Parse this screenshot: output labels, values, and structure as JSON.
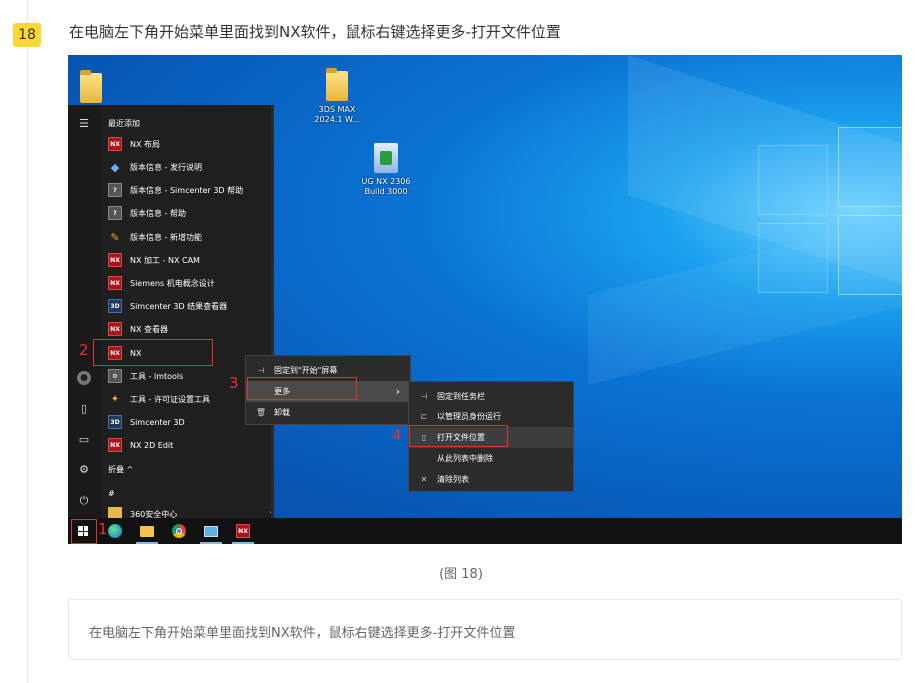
{
  "step": {
    "number": "18",
    "heading": "在电脑左下角开始菜单里面找到NX软件，鼠标右键选择更多-打开文件位置"
  },
  "desktop": {
    "icons": [
      {
        "label_line1": "3DS MAX",
        "label_line2": "2024.1 W...",
        "icon": "folder-icon"
      },
      {
        "label_line1": "UG NX 2306",
        "label_line2": "Build 3000",
        "icon": "nx-installer-icon"
      }
    ]
  },
  "start_menu": {
    "header": "最近添加",
    "items": [
      {
        "label": "NX 布局",
        "icon": "NX"
      },
      {
        "label": "版本信息 - 发行说明",
        "icon": "doc"
      },
      {
        "label": "版本信息 - Simcenter 3D 帮助",
        "icon": "help"
      },
      {
        "label": "版本信息 - 帮助",
        "icon": "help"
      },
      {
        "label": "版本信息 - 新增功能",
        "icon": "new"
      },
      {
        "label": "NX 加工 - NX CAM",
        "icon": "NX"
      },
      {
        "label": "Siemens 机电概念设计",
        "icon": "NX"
      },
      {
        "label": "Simcenter 3D 结果查看器",
        "icon": "3D"
      },
      {
        "label": "NX 查看器",
        "icon": "NX"
      },
      {
        "label": "NX",
        "icon": "NX"
      },
      {
        "label": "工具 - lmtools",
        "icon": "tool"
      },
      {
        "label": "工具 - 许可证设置工具",
        "icon": "key"
      },
      {
        "label": "Simcenter 3D",
        "icon": "3D"
      },
      {
        "label": "NX 2D Edit",
        "icon": "NX"
      }
    ],
    "collapse_label": "折叠 ^",
    "section_hash": "#",
    "partial_item": "360安全中心"
  },
  "context_menu": {
    "items": [
      {
        "label": "固定到\"开始\"屏幕",
        "icon": "pin"
      },
      {
        "label": "更多",
        "icon": ""
      },
      {
        "label": "卸载",
        "icon": "trash"
      }
    ],
    "arrow": "›"
  },
  "submenu": {
    "items": [
      {
        "label": "固定到任务栏",
        "icon": "pin"
      },
      {
        "label": "以管理员身份运行",
        "icon": "admin"
      },
      {
        "label": "打开文件位置",
        "icon": "file"
      },
      {
        "label": "从此列表中删除",
        "icon": ""
      },
      {
        "label": "清除列表",
        "icon": "x"
      }
    ]
  },
  "markers": {
    "m1": "1",
    "m2": "2",
    "m3": "3",
    "m4": "4"
  },
  "caption": "(图 18)",
  "note": "在电脑左下角开始菜单里面找到NX软件，鼠标右键选择更多-打开文件位置",
  "colors": {
    "badge": "#fdd835",
    "marker": "#e0342d",
    "desktop": "#0a73d4",
    "menu": "#2b2b2b"
  }
}
